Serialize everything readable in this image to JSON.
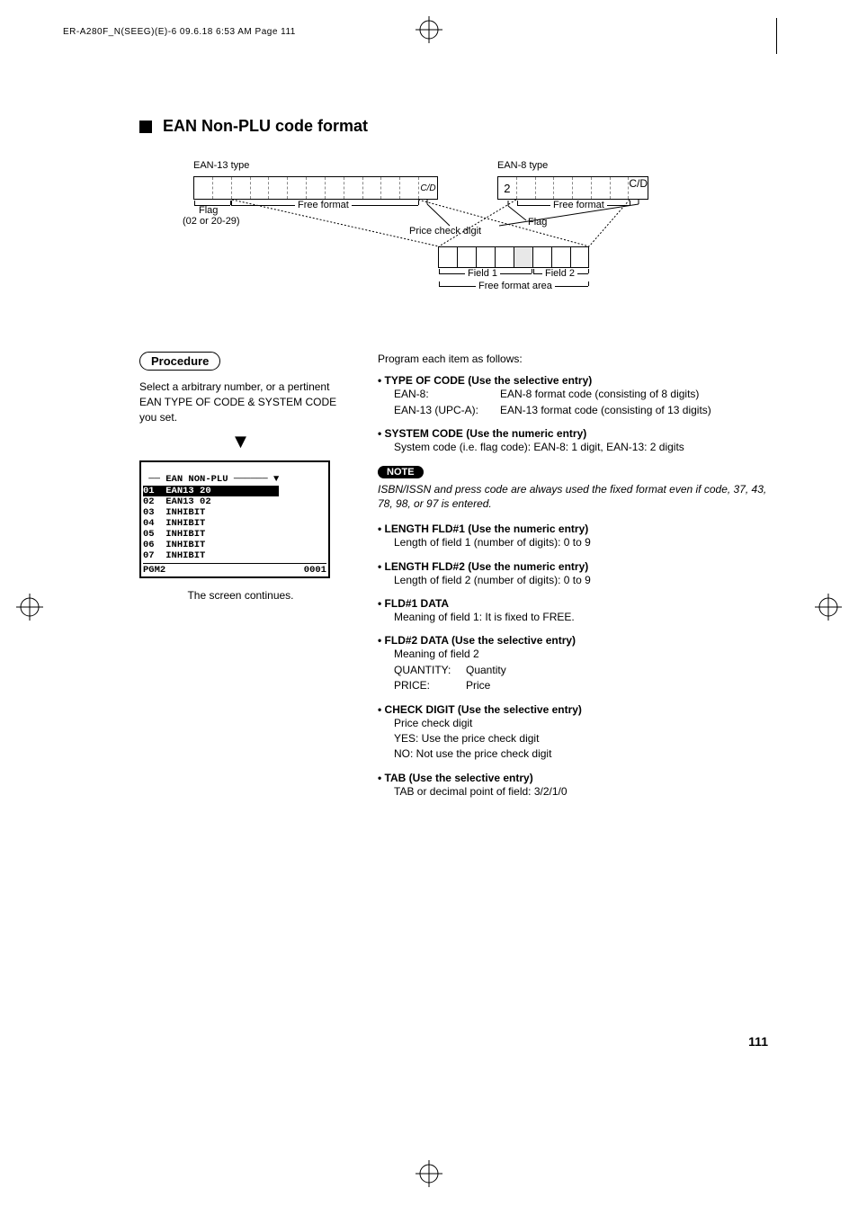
{
  "header": "ER-A280F_N(SEEG)(E)-6  09.6.18 6:53 AM  Page 111",
  "section_title": "EAN Non-PLU code format",
  "diagram": {
    "ean13_label": "EAN-13 type",
    "ean8_label": "EAN-8 type",
    "flag": "Flag",
    "flag_sub": "(02 or 20-29)",
    "free_format": "Free format",
    "price_check_digit": "Price check digit",
    "field1": "Field 1",
    "field2": "Field 2",
    "free_format_area": "Free format area",
    "cd": "C/D",
    "ean8_first": "2",
    "flag2": "Flag"
  },
  "procedure": {
    "pill": "Procedure",
    "text": "Select a arbitrary number, or a pertinent EAN TYPE OF CODE & SYSTEM CODE you set.",
    "screen_title": "EAN NON-PLU",
    "rows": [
      {
        "n": "01",
        "t": "EAN13 20",
        "hl": true
      },
      {
        "n": "02",
        "t": "EAN13 02"
      },
      {
        "n": "03",
        "t": "INHIBIT"
      },
      {
        "n": "04",
        "t": "INHIBIT"
      },
      {
        "n": "05",
        "t": "INHIBIT"
      },
      {
        "n": "06",
        "t": "INHIBIT"
      },
      {
        "n": "07",
        "t": "INHIBIT"
      }
    ],
    "status_left": "PGM2",
    "status_right": "0001",
    "continues": "The screen continues.",
    "arrow_char": "▼",
    "scroll_char": "▼"
  },
  "right": {
    "intro": "Program each item as follows:",
    "type_title": "• TYPE OF CODE (Use the selective entry)",
    "type_ean8_lbl": "EAN-8:",
    "type_ean8_val": "EAN-8 format code (consisting of 8 digits)",
    "type_ean13_lbl": "EAN-13 (UPC-A):",
    "type_ean13_val": "EAN-13 format code (consisting of 13 digits)",
    "system_title": "• SYSTEM CODE (Use the numeric entry)",
    "system_body": "System code (i.e. flag code):  EAN-8: 1 digit, EAN-13: 2 digits",
    "note_pill": "NOTE",
    "note_text": "ISBN/ISSN and press code are always used the  fixed format even if code, 37, 43, 78, 98, or 97 is entered.",
    "len1_title": "• LENGTH FLD#1 (Use the numeric entry)",
    "len1_body": "Length of field 1 (number of digits): 0 to 9",
    "len2_title": "• LENGTH FLD#2 (Use the numeric entry)",
    "len2_body": "Length of field 2 (number of digits): 0 to 9",
    "fld1_title": "• FLD#1 DATA",
    "fld1_body": "Meaning of field 1:  It is fixed to FREE.",
    "fld2_title": "• FLD#2 DATA (Use the selective entry)",
    "fld2_l1": "Meaning of field 2",
    "fld2_l2a": "QUANTITY:",
    "fld2_l2b": "Quantity",
    "fld2_l3a": "PRICE:",
    "fld2_l3b": "Price",
    "chk_title": "• CHECK DIGIT (Use the selective entry)",
    "chk_l1": "Price check digit",
    "chk_l2": "YES:  Use the price check digit",
    "chk_l3": "NO:   Not use the price check digit",
    "tab_title": "• TAB (Use the selective entry)",
    "tab_body": "TAB or decimal point of field: 3/2/1/0"
  },
  "pagenum": "111"
}
